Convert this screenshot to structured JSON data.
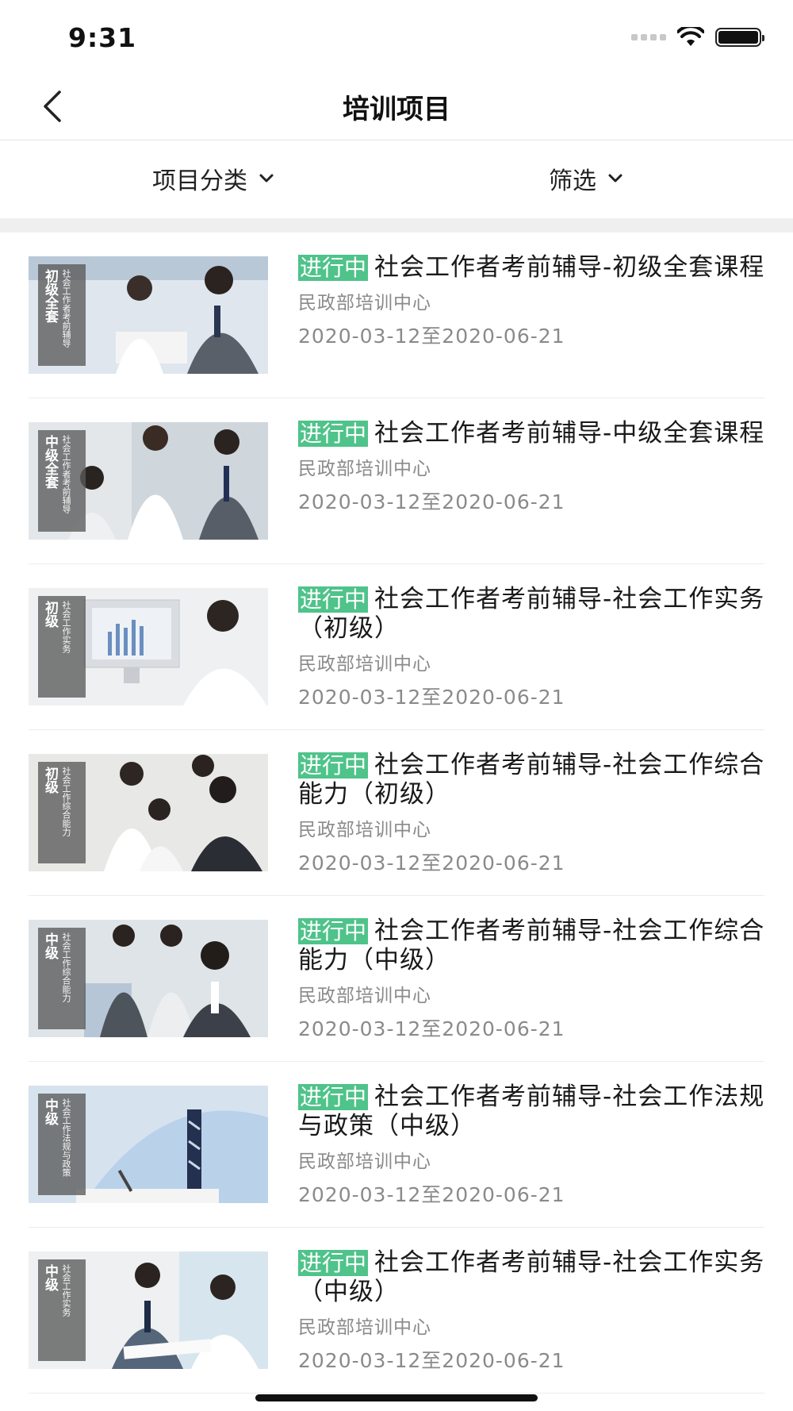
{
  "status_bar": {
    "time": "9:31"
  },
  "nav": {
    "title": "培训项目"
  },
  "filters": {
    "category_label": "项目分类",
    "screen_label": "筛选"
  },
  "courses": [
    {
      "status": "进行中",
      "title": "社会工作者考前辅导-初级全套课程",
      "org": "民政部培训中心",
      "date": "2020-03-12至2020-06-21",
      "thumb_level": "初级全套",
      "thumb_sub": "社会工作者考前辅导"
    },
    {
      "status": "进行中",
      "title": "社会工作者考前辅导-中级全套课程",
      "org": "民政部培训中心",
      "date": "2020-03-12至2020-06-21",
      "thumb_level": "中级全套",
      "thumb_sub": "社会工作者考前辅导"
    },
    {
      "status": "进行中",
      "title": "社会工作者考前辅导-社会工作实务（初级）",
      "org": "民政部培训中心",
      "date": "2020-03-12至2020-06-21",
      "thumb_level": "初级",
      "thumb_sub": "社会工作实务"
    },
    {
      "status": "进行中",
      "title": "社会工作者考前辅导-社会工作综合能力（初级）",
      "org": "民政部培训中心",
      "date": "2020-03-12至2020-06-21",
      "thumb_level": "初级",
      "thumb_sub": "社会工作综合能力"
    },
    {
      "status": "进行中",
      "title": "社会工作者考前辅导-社会工作综合能力（中级）",
      "org": "民政部培训中心",
      "date": "2020-03-12至2020-06-21",
      "thumb_level": "中级",
      "thumb_sub": "社会工作综合能力"
    },
    {
      "status": "进行中",
      "title": "社会工作者考前辅导-社会工作法规与政策（中级）",
      "org": "民政部培训中心",
      "date": "2020-03-12至2020-06-21",
      "thumb_level": "中级",
      "thumb_sub": "社会工作法规与政策"
    },
    {
      "status": "进行中",
      "title": "社会工作者考前辅导-社会工作实务（中级）",
      "org": "民政部培训中心",
      "date": "2020-03-12至2020-06-21",
      "thumb_level": "中级",
      "thumb_sub": "社会工作实务"
    }
  ],
  "icons": {
    "back": "back-chevron-icon",
    "dropdown": "chevron-down-icon",
    "wifi": "wifi-icon",
    "battery": "battery-icon",
    "signal": "signal-icon"
  },
  "colors": {
    "status_tag": "#4fc38a",
    "secondary_text": "#8a8a8a",
    "divider": "#efefef"
  }
}
